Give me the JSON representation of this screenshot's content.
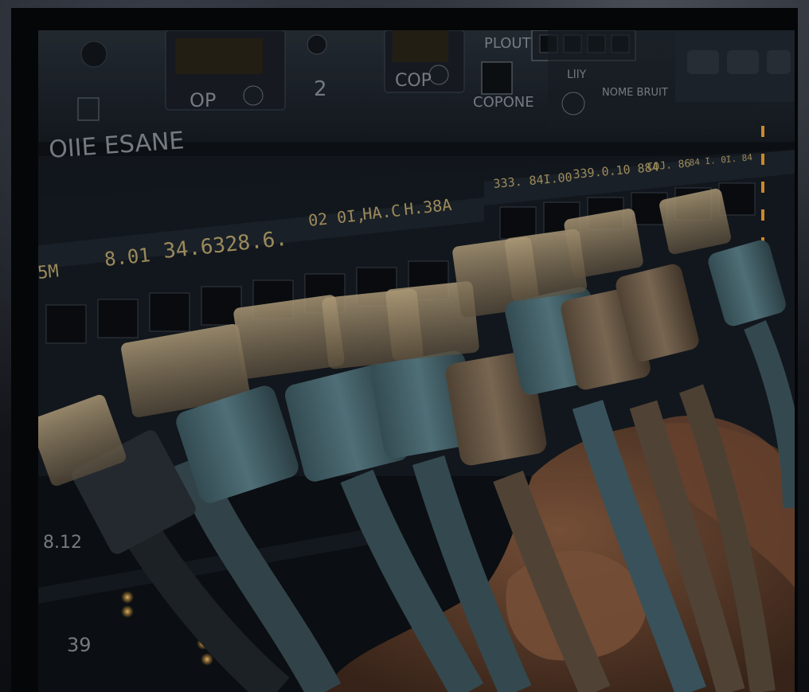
{
  "image": {
    "subject": "rj45-cables-in-network-switch",
    "colors": {
      "panel": "#1b222b",
      "cable_teal": "#4f6f78",
      "cable_tan": "#7d6a55",
      "led_amber": "#f0a030",
      "skin": "#8a5a3c"
    }
  },
  "panel_labels": {
    "port_op": "OP",
    "port_2": "2",
    "port_cop": "COP",
    "plout": "PLOUT",
    "copone": "COPONE",
    "lily": "LllY",
    "nome_bruit": "NOME BRUIT",
    "oie_esane": "OIIE ESANE"
  },
  "row_labels": {
    "left_1": "5M",
    "left_2": "8.01",
    "left_3": "34.6328.6.",
    "mid_1": "02 0I,",
    "mid_2": "HA.C",
    "mid_3": "H.38A",
    "right_1": "333. 84I.00",
    "right_2": "339.0.10 884",
    "right_3": "C0J. 86",
    "right_4": "84 I. 0I. 84"
  },
  "lower_labels": {
    "left_a": "8.12",
    "left_b": "39"
  }
}
